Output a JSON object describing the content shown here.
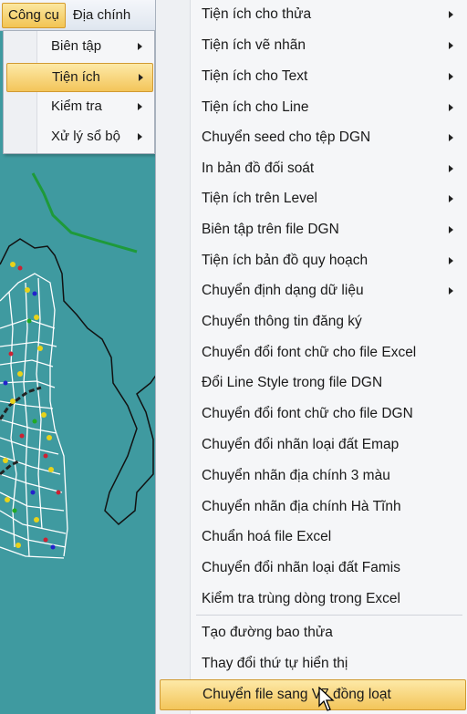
{
  "menubar": [
    {
      "label": "Công cụ",
      "active": true
    },
    {
      "label": "Địa chính",
      "active": false
    }
  ],
  "menu1": [
    {
      "label": "Biên tập",
      "submenu": true,
      "active": false
    },
    {
      "label": "Tiện ích",
      "submenu": true,
      "active": true
    },
    {
      "label": "Kiểm tra",
      "submenu": true,
      "active": false
    },
    {
      "label": "Xử lý sổ bộ",
      "submenu": true,
      "active": false
    }
  ],
  "menu2": [
    {
      "label": "Tiện ích cho thửa",
      "submenu": true
    },
    {
      "label": "Tiện ích vẽ nhãn",
      "submenu": true
    },
    {
      "label": "Tiện ích cho Text",
      "submenu": true
    },
    {
      "label": "Tiện ích cho Line",
      "submenu": true
    },
    {
      "label": "Chuyển seed cho tệp DGN",
      "submenu": true
    },
    {
      "label": "In bản đồ đối soát",
      "submenu": true
    },
    {
      "label": "Tiện ích trên Level",
      "submenu": true
    },
    {
      "label": "Biên tập trên file DGN",
      "submenu": true
    },
    {
      "label": "Tiện ích bản đồ quy hoạch",
      "submenu": true
    },
    {
      "label": "Chuyển định dạng dữ liệu",
      "submenu": true
    },
    {
      "label": "Chuyển thông tin đăng ký",
      "submenu": false
    },
    {
      "label": "Chuyển đổi font chữ cho file Excel",
      "submenu": false
    },
    {
      "label": "Đổi Line Style trong file DGN",
      "submenu": false
    },
    {
      "label": "Chuyển đổi font chữ cho file DGN",
      "submenu": false
    },
    {
      "label": "Chuyển đổi nhãn loại đất Emap",
      "submenu": false
    },
    {
      "label": "Chuyển nhãn địa chính 3 màu",
      "submenu": false
    },
    {
      "label": "Chuyển nhãn địa chính Hà Tĩnh",
      "submenu": false
    },
    {
      "label": "Chuẩn hoá file Excel",
      "submenu": false
    },
    {
      "label": "Chuyển đổi nhãn loại đất Famis",
      "submenu": false
    },
    {
      "label": "Kiểm tra trùng dòng trong Excel",
      "submenu": false
    },
    {
      "label": "Tạo đường bao thửa",
      "submenu": false,
      "separator_before": true
    },
    {
      "label": "Thay đổi thứ tự hiển thị",
      "submenu": false
    },
    {
      "label": "Chuyển file sang V7 đồng loạt",
      "submenu": false,
      "active": true
    }
  ],
  "colors": {
    "map_background": "#3f9aa0",
    "highlight": "#f3c55a",
    "menu_background": "#f5f6f8"
  },
  "icons": {
    "cursor": "mouse-pointer-icon"
  }
}
